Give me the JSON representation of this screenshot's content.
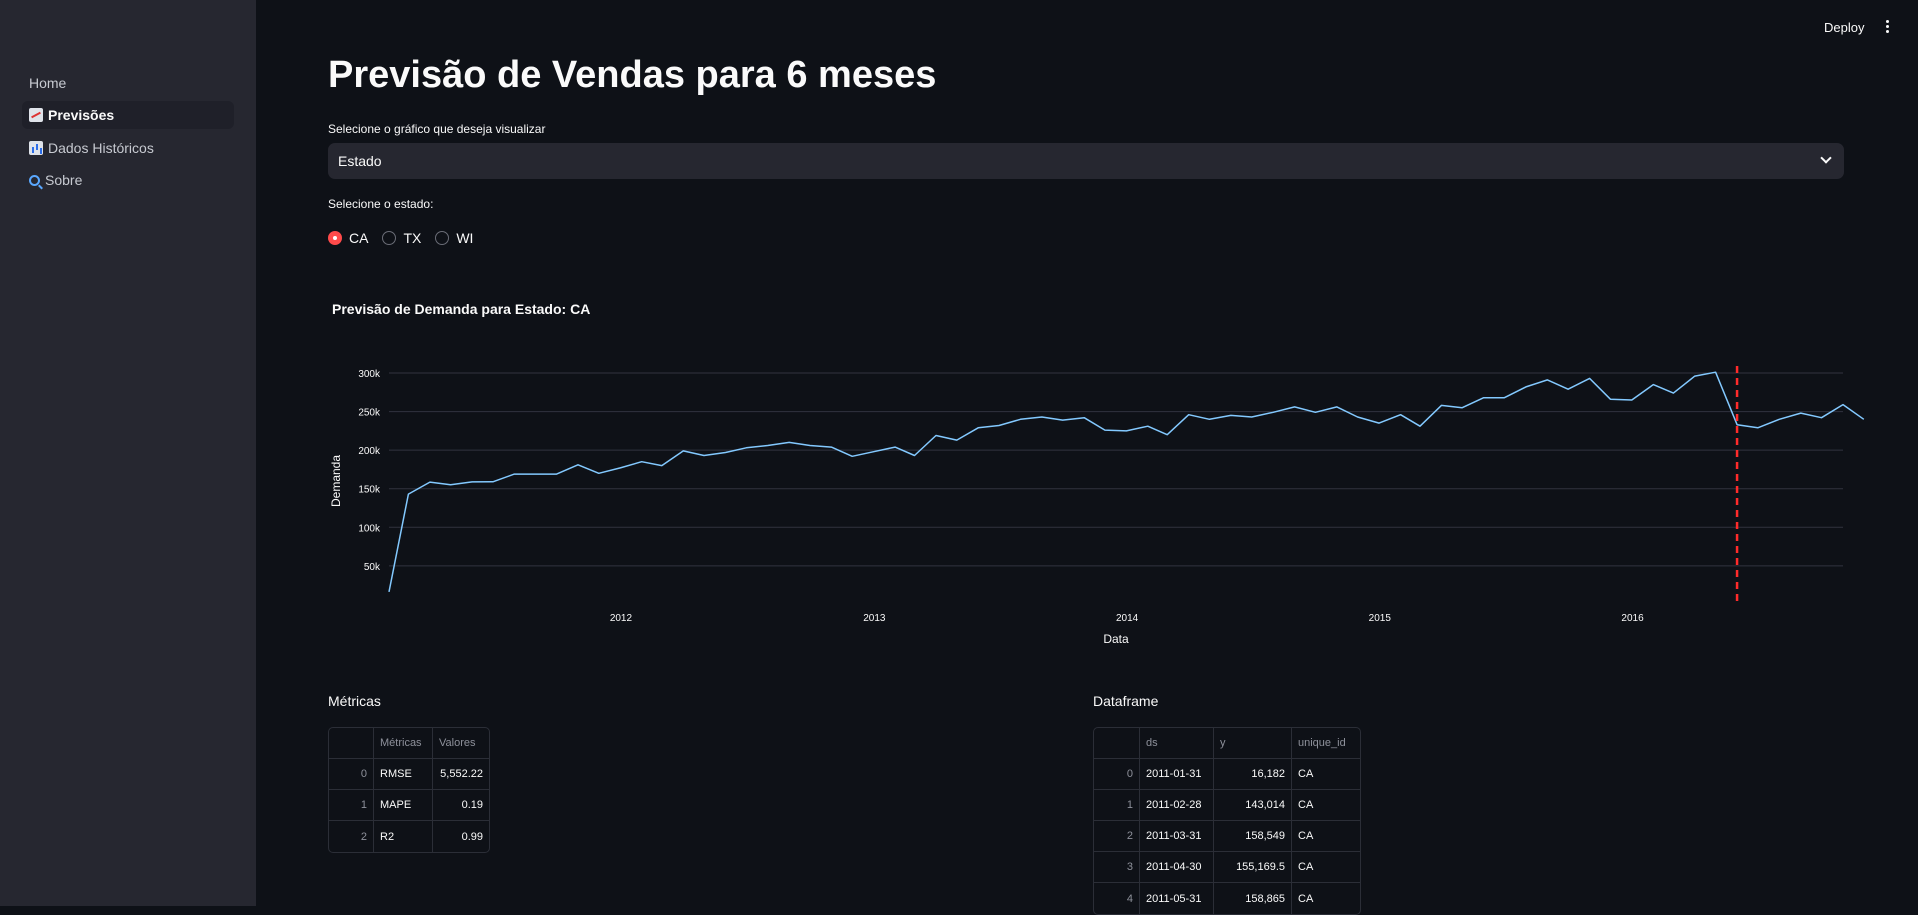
{
  "header": {
    "deploy_label": "Deploy"
  },
  "sidebar": {
    "items": [
      {
        "label": "Home",
        "icon": ""
      },
      {
        "label": "Previsões",
        "icon": "chart-increasing-icon"
      },
      {
        "label": "Dados Históricos",
        "icon": "bar-chart-icon"
      },
      {
        "label": "Sobre",
        "icon": "magnifier-icon"
      }
    ]
  },
  "main": {
    "title": "Previsão de Vendas para 6 meses",
    "select_label": "Selecione o gráfico que deseja visualizar",
    "select_value": "Estado",
    "radio_label": "Selecione o estado:",
    "radio_options": [
      "CA",
      "TX",
      "WI"
    ],
    "radio_selected": "CA"
  },
  "chart_data": {
    "type": "line",
    "title": "Previsão de Demanda para Estado: CA",
    "xlabel": "Data",
    "ylabel": "Demanda",
    "y_ticks": [
      "50k",
      "100k",
      "150k",
      "200k",
      "250k",
      "300k"
    ],
    "x_ticks": [
      "2012",
      "2013",
      "2014",
      "2015",
      "2016"
    ],
    "ylim": [
      20000,
      305000
    ],
    "grid": true,
    "line_color": "#83c9ff",
    "forecast_marker_color": "#ff2b2b",
    "forecast_start": "2016-05-31",
    "series": [
      {
        "x_start": "2011-01-31",
        "x_end": "2016-10-31",
        "frequency": "monthly",
        "values": [
          16182,
          143014,
          158549,
          155169.5,
          158865,
          159000,
          169000,
          169000,
          169000,
          181000,
          170000,
          177000,
          185000,
          180000,
          199000,
          193000,
          197000,
          203000,
          206000,
          210000,
          206000,
          204000,
          192000,
          198000,
          204000,
          193000,
          219000,
          213000,
          229000,
          232000,
          240000,
          243000,
          239000,
          242000,
          226000,
          225000,
          231000,
          220000,
          246000,
          240000,
          245000,
          243000,
          249000,
          256000,
          249000,
          256000,
          243000,
          235000,
          246000,
          231000,
          258000,
          255000,
          268000,
          268000,
          282000,
          291000,
          279000,
          293000,
          266000,
          265000,
          285000,
          274000,
          296000,
          301000,
          233000,
          229000,
          240000,
          248000,
          242000,
          259000,
          240000
        ]
      }
    ]
  },
  "metrics": {
    "title": "Métricas",
    "columns": [
      "",
      "Métricas",
      "Valores"
    ],
    "rows": [
      [
        "0",
        "RMSE",
        "5,552.22"
      ],
      [
        "1",
        "MAPE",
        "0.19"
      ],
      [
        "2",
        "R2",
        "0.99"
      ]
    ]
  },
  "dataframe": {
    "title": "Dataframe",
    "columns": [
      "",
      "ds",
      "y",
      "unique_id"
    ],
    "rows": [
      [
        "0",
        "2011-01-31",
        "16,182",
        "CA"
      ],
      [
        "1",
        "2011-02-28",
        "143,014",
        "CA"
      ],
      [
        "2",
        "2011-03-31",
        "158,549",
        "CA"
      ],
      [
        "3",
        "2011-04-30",
        "155,169.5",
        "CA"
      ],
      [
        "4",
        "2011-05-31",
        "158,865",
        "CA"
      ]
    ]
  }
}
